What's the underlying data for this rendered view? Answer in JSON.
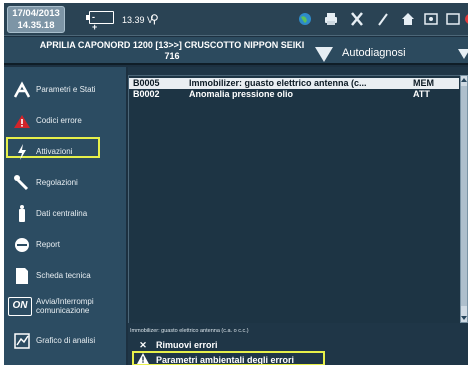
{
  "status": {
    "date": "17/04/2013",
    "time": "14.35.18",
    "battery_symbols": "- +",
    "voltage": "13.39 V"
  },
  "toolbar_icons": [
    "globe-icon",
    "printer-icon",
    "tools-icon",
    "pen-icon",
    "home-icon",
    "image-icon",
    "window-icon",
    "close-icon"
  ],
  "header": {
    "vehicle_line1": "APRILIA CAPONORD 1200 [13>>] CRUSCOTTO NIPPON SEIKI",
    "vehicle_line2": "716",
    "section": "Autodiagnosi"
  },
  "sidebar": {
    "items": [
      {
        "label": "Parametri e Stati",
        "icon": "gauge-icon"
      },
      {
        "label": "Codici errore",
        "icon": "warning-icon"
      },
      {
        "label": "Attivazioni",
        "icon": "activation-icon"
      },
      {
        "label": "Regolazioni",
        "icon": "wrench-icon"
      },
      {
        "label": "Dati centralina",
        "icon": "ecu-icon"
      },
      {
        "label": "Report",
        "icon": "report-icon"
      },
      {
        "label": "Scheda tecnica",
        "icon": "document-icon"
      },
      {
        "label": "Avvia/Interrompi comunicazione",
        "icon": "on-icon"
      },
      {
        "label": "Grafico di analisi",
        "icon": "graph-icon"
      }
    ],
    "on_text": "ON"
  },
  "errors": {
    "rows": [
      {
        "code": "B0005",
        "description": "Immobilizer: guasto elettrico antenna (c...",
        "status": "MEM"
      },
      {
        "code": "B0002",
        "description": "Anomalia pressione olio",
        "status": "ATT"
      }
    ],
    "detail": "Immobilizer: guasto elettrico antenna (c.a. o c.c.)"
  },
  "actions": {
    "remove": "Rimuovi errori",
    "env_params": "Parametri ambientali degli errori"
  },
  "colors": {
    "highlight": "#e7f04a",
    "warning_red": "#d3242a",
    "background": "#1c3040"
  }
}
